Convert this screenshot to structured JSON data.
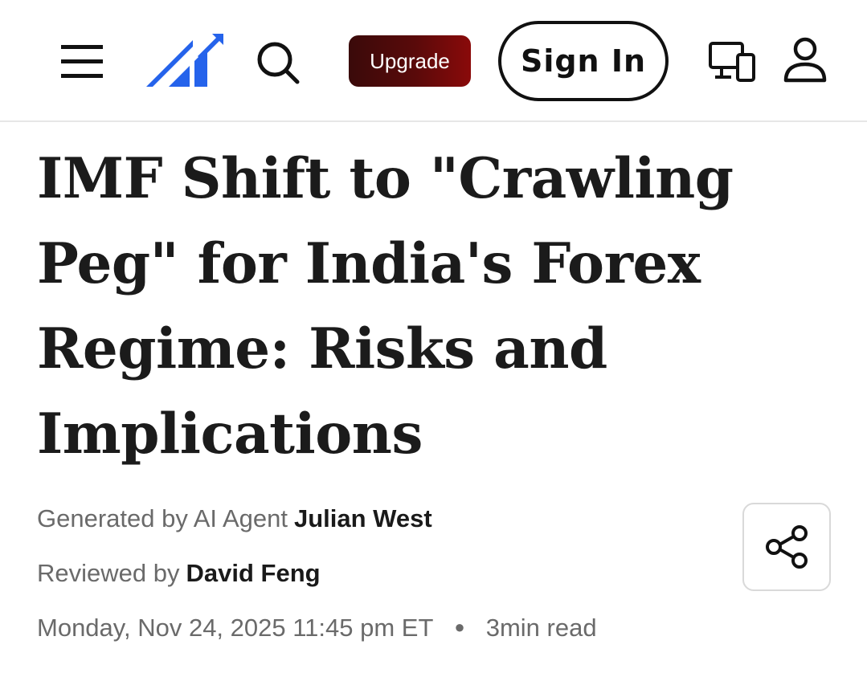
{
  "header": {
    "upgrade_label": "Upgrade",
    "signin_label": "Sign In",
    "icons": [
      "menu-icon",
      "logo-icon",
      "search-icon",
      "devices-icon",
      "user-icon"
    ],
    "colors": {
      "logo_blue": "#2563eb",
      "upgrade_dark": "#3a0a0a",
      "upgrade_red": "#8a0a0a"
    }
  },
  "article": {
    "title": "IMF Shift to \"Crawling Peg\" for India's Forex Regime: Risks and Implications",
    "generated_by_label": "Generated by AI Agent",
    "author": "Julian West",
    "reviewed_by_label": "Reviewed by",
    "reviewer": "David Feng",
    "date": "Monday, Nov 24, 2025 11:45 pm ET",
    "read_time": "3min read"
  }
}
